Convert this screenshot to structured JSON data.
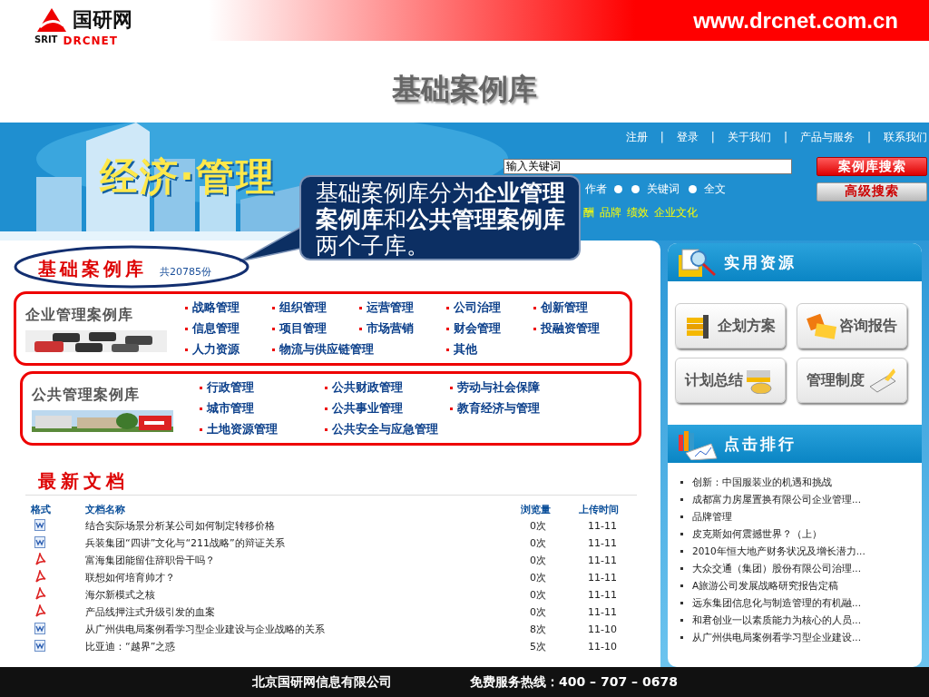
{
  "slide": {
    "logo": {
      "cn": "国研网",
      "en_left": "SRIT",
      "en_right": "DRCNET"
    },
    "url": "www.drcnet.com.cn",
    "title": "基础案例库"
  },
  "site": {
    "banner_title": "经济·管理",
    "nav": [
      "注册",
      "登录",
      "关于我们",
      "产品与服务",
      "联系我们"
    ],
    "nav_separator": "|",
    "search": {
      "value": "输入关键词"
    },
    "search_buttons": [
      "案例库搜索",
      "高级搜索"
    ],
    "search_options": [
      {
        "label": "作者",
        "selected": false
      },
      {
        "label": "关键词",
        "selected": false
      },
      {
        "label": "全文",
        "selected": false
      }
    ],
    "hot_tags": [
      "酬",
      "品牌",
      "绩效",
      "企业文化"
    ]
  },
  "callout": "基础案例库分为**企业管理案例库**和**公共管理案例库**两个子库。",
  "library": {
    "title": "基础案例库",
    "count": "共20785份",
    "groups": [
      {
        "name": "企业管理案例库",
        "links": [
          "战略管理",
          "组织管理",
          "运营管理",
          "公司治理",
          "创新管理",
          "信息管理",
          "项目管理",
          "市场营销",
          "财会管理",
          "投融资管理",
          "人力资源",
          "物流与供应链管理",
          "其他"
        ]
      },
      {
        "name": "公共管理案例库",
        "links": [
          "行政管理",
          "公共财政管理",
          "劳动与社会保障",
          "城市管理",
          "公共事业管理",
          "教育经济与管理",
          "土地资源管理",
          "公共安全与应急管理"
        ]
      }
    ]
  },
  "documents": {
    "title": "最新文档",
    "columns": [
      "格式",
      "文档名称",
      "浏览量",
      "上传时间"
    ],
    "rows": [
      {
        "kind": "doc",
        "name": "结合实际场景分析某公司如何制定转移价格",
        "views": "0次",
        "date": "11-11"
      },
      {
        "kind": "doc",
        "name": "兵装集团“四讲”文化与“211战略”的辩证关系",
        "views": "0次",
        "date": "11-11"
      },
      {
        "kind": "pdf",
        "name": "富海集团能留住辞职骨干吗？",
        "views": "0次",
        "date": "11-11"
      },
      {
        "kind": "pdf",
        "name": "联想如何培育帅才？",
        "views": "0次",
        "date": "11-11"
      },
      {
        "kind": "pdf",
        "name": "海尔新模式之核",
        "views": "0次",
        "date": "11-11"
      },
      {
        "kind": "pdf",
        "name": "产品线押注式升级引发的血案",
        "views": "0次",
        "date": "11-11"
      },
      {
        "kind": "doc",
        "name": "从广州供电局案例看学习型企业建设与企业战略的关系",
        "views": "8次",
        "date": "11-10"
      },
      {
        "kind": "doc",
        "name": "比亚迪：“越界”之惑",
        "views": "5次",
        "date": "11-10"
      }
    ]
  },
  "resources": {
    "title": "实用资源",
    "items": [
      {
        "label": "企划方案",
        "kind": "binders"
      },
      {
        "label": "咨询报告",
        "kind": "report"
      },
      {
        "label": "计划总结",
        "kind": "tea"
      },
      {
        "label": "管理制度",
        "kind": "notebook"
      }
    ]
  },
  "ranking": {
    "title": "点击排行",
    "items": [
      "创新：中国服装业的机遇和挑战",
      "成都富力房屋置换有限公司企业管理...",
      "品牌管理",
      "皮克斯如何震撼世界？（上）",
      "2010年恒大地产财务状况及增长潜力...",
      "大众交通（集团）股份有限公司治理...",
      "A旅游公司发展战略研究报告定稿",
      "远东集团信息化与制造管理的有机融...",
      "和君创业一以素质能力为核心的人员...",
      "从广州供电局案例看学习型企业建设..."
    ]
  },
  "footer": {
    "company": "北京国研网信息有限公司",
    "hotline": "免费服务热线：400 – 707 – 0678"
  }
}
